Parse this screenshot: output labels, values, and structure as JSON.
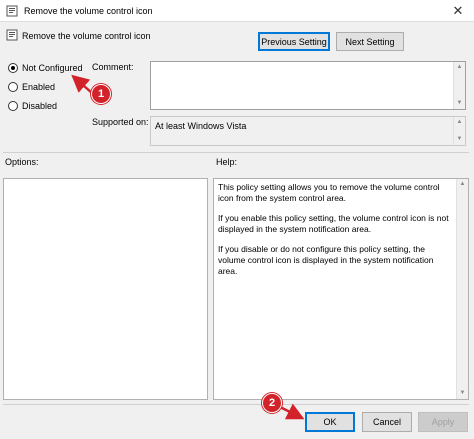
{
  "window": {
    "title": "Remove the volume control icon",
    "close_symbol": "✕"
  },
  "header": {
    "policy_name": "Remove the volume control icon",
    "previous_label": "Previous Setting",
    "next_label": "Next Setting"
  },
  "state": {
    "options": [
      {
        "label": "Not Configured",
        "checked": true
      },
      {
        "label": "Enabled",
        "checked": false
      },
      {
        "label": "Disabled",
        "checked": false
      }
    ]
  },
  "comment": {
    "label": "Comment:",
    "value": ""
  },
  "supported": {
    "label": "Supported on:",
    "value": "At least Windows Vista"
  },
  "options_panel": {
    "label": "Options:"
  },
  "help": {
    "label": "Help:",
    "paragraphs": [
      "This policy setting allows you to remove the volume control icon from the system control area.",
      "If you enable this policy setting, the volume control icon is not displayed in the system notification area.",
      "If you disable or do not configure this policy setting, the volume control icon is displayed in the system notification area."
    ]
  },
  "footer": {
    "ok_label": "OK",
    "cancel_label": "Cancel",
    "apply_label": "Apply"
  },
  "annotations": {
    "badge1": "1",
    "badge2": "2",
    "color": "#d2232a"
  }
}
